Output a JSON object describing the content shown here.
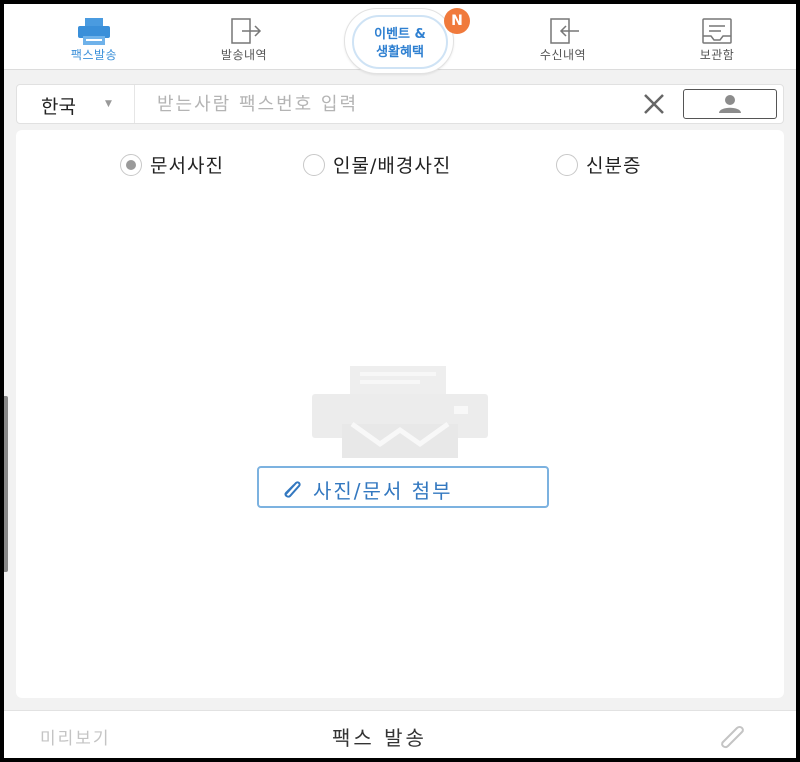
{
  "nav": {
    "tabs": [
      {
        "label": "팩스발송",
        "icon": "fax-printer-icon",
        "active": true
      },
      {
        "label": "발송내역",
        "icon": "sent-history-icon",
        "active": false
      },
      {
        "label": "수신내역",
        "icon": "received-history-icon",
        "active": false
      },
      {
        "label": "보관함",
        "icon": "storage-box-icon",
        "active": false
      }
    ],
    "event": {
      "line1": "이벤트 &",
      "line2": "생활혜택",
      "badge": "N"
    }
  },
  "recipient": {
    "country": "한국",
    "placeholder": "받는사람 팩스번호 입력",
    "value": ""
  },
  "photo_types": [
    {
      "label": "문서사진",
      "selected": true
    },
    {
      "label": "인물/배경사진",
      "selected": false
    },
    {
      "label": "신분증",
      "selected": false
    }
  ],
  "attach": {
    "label": "사진/문서 첨부",
    "icon": "paperclip-icon"
  },
  "bottom": {
    "preview": "미리보기",
    "send": "팩스 발송",
    "attach_icon": "paperclip-icon"
  },
  "colors": {
    "accent": "#3a8fd9",
    "badge": "#f07a3c",
    "attach_border": "#7cb2e0",
    "background": "#f2f2f2"
  }
}
